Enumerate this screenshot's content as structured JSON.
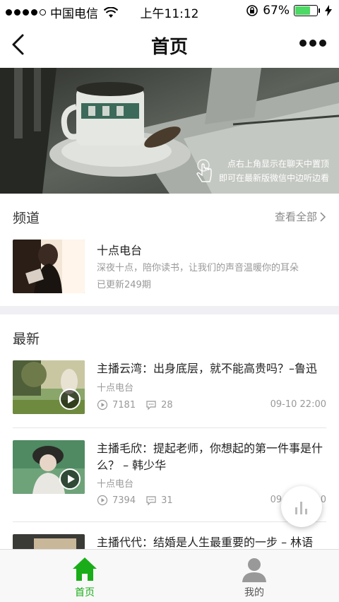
{
  "status_bar": {
    "carrier": "中国电信",
    "time": "上午11:12",
    "battery": "67%",
    "battery_level": 0.67
  },
  "nav": {
    "title": "首页"
  },
  "banner": {
    "hint_line1": "点右上角显示在聊天中置顶",
    "hint_line2": "即可在最新版微信中边听边看"
  },
  "channel_section": {
    "title": "频道",
    "see_all": "查看全部",
    "channel": {
      "name": "十点电台",
      "desc": "深夜十点，陪你读书，让我们的声音温暖你的耳朵",
      "updated": "已更新249期"
    }
  },
  "latest_section": {
    "title": "最新",
    "items": [
      {
        "title": "主播云湾：出身底层，就不能高贵吗？–鲁迅",
        "source": "十点电台",
        "plays": "7181",
        "comments": "28",
        "date": "09-10 22:00"
      },
      {
        "title": "主播毛欣：提起老师，你想起的第一件事是什么？ – 韩少华",
        "source": "十点电台",
        "plays": "7394",
        "comments": "31",
        "date": "09-10 22:00"
      },
      {
        "title": "主播代代：结婚是人生最重要的一步 – 林语"
      }
    ]
  },
  "tab_bar": {
    "tabs": [
      {
        "label": "首页",
        "active": true
      },
      {
        "label": "我的",
        "active": false
      }
    ]
  },
  "colors": {
    "accent": "#1aad19",
    "inactive_tab": "#7b7b7b"
  }
}
